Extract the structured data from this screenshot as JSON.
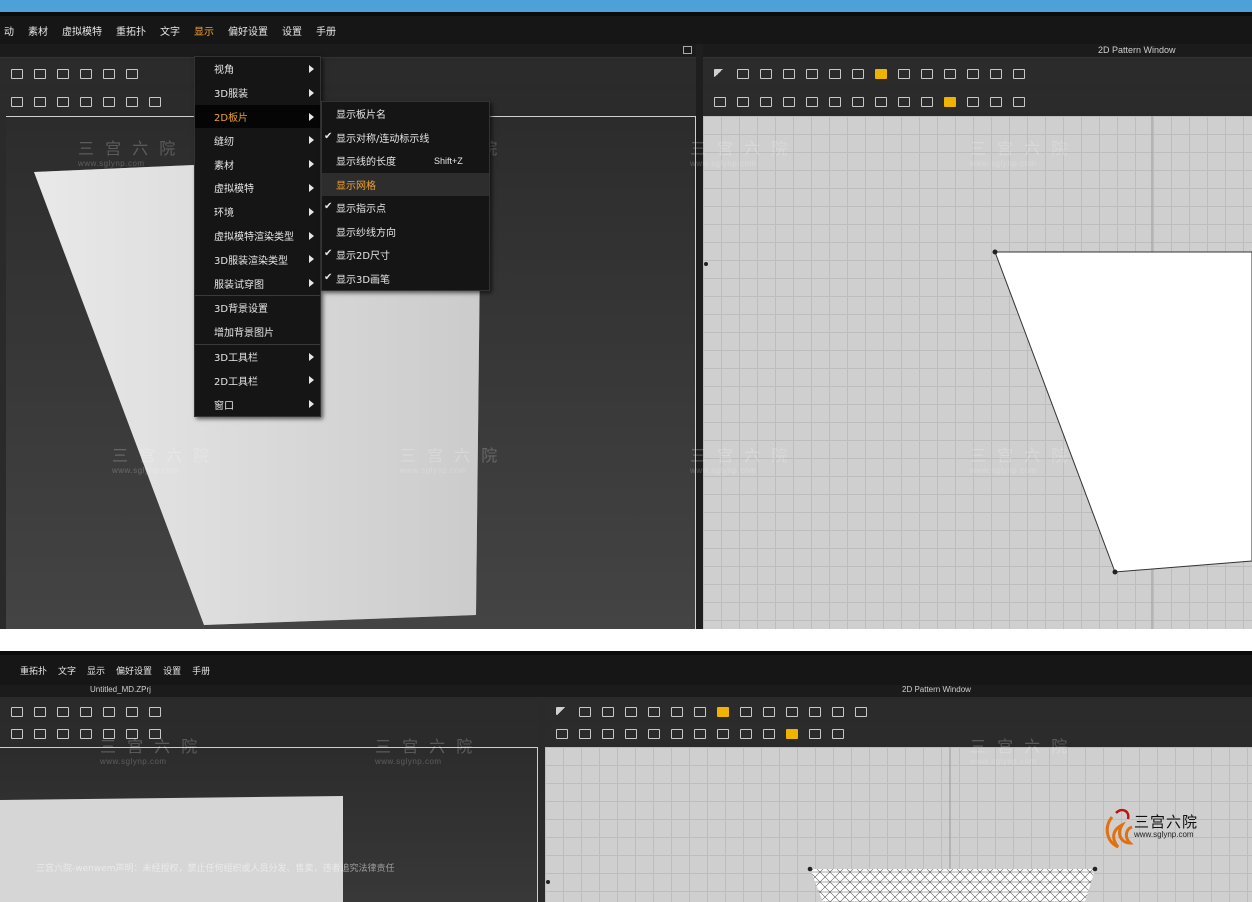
{
  "top": {
    "menu": [
      "动",
      "素材",
      "虚拟模特",
      "重拓扑",
      "文字",
      "显示",
      "偏好设置",
      "设置",
      "手册"
    ],
    "active_menu_index": 5,
    "pattern_window_title": "2D Pattern Window"
  },
  "display_menu": {
    "items": [
      {
        "label": "视角",
        "arrow": true
      },
      {
        "label": "3D服装",
        "arrow": true
      },
      {
        "label": "2D板片",
        "arrow": true
      },
      {
        "label": "缝纫",
        "arrow": true
      },
      {
        "label": "素材",
        "arrow": true
      },
      {
        "label": "虚拟模特",
        "arrow": true
      },
      {
        "label": "环境",
        "arrow": true
      },
      {
        "label": "虚拟模特渲染类型",
        "arrow": true
      },
      {
        "label": "3D服装渲染类型",
        "arrow": true
      },
      {
        "label": "服装试穿图",
        "arrow": true
      },
      {
        "label": "3D背景设置",
        "arrow": false
      },
      {
        "label": "增加背景图片",
        "arrow": false
      },
      {
        "label": "3D工具栏",
        "arrow": true
      },
      {
        "label": "2D工具栏",
        "arrow": true
      },
      {
        "label": "窗口",
        "arrow": true
      }
    ],
    "active_index": 2
  },
  "submenu_2d_pattern": {
    "items": [
      {
        "label": "显示板片名",
        "checked": false,
        "shortcut": ""
      },
      {
        "label": "显示对称/连动标示线",
        "checked": true,
        "shortcut": ""
      },
      {
        "label": "显示线的长度",
        "checked": false,
        "shortcut": "Shift+Z"
      },
      {
        "label": "显示网格",
        "checked": false,
        "shortcut": ""
      },
      {
        "label": "显示指示点",
        "checked": true,
        "shortcut": ""
      },
      {
        "label": "显示纱线方向",
        "checked": false,
        "shortcut": ""
      },
      {
        "label": "显示2D尺寸",
        "checked": true,
        "shortcut": ""
      },
      {
        "label": "显示3D画笔",
        "checked": true,
        "shortcut": ""
      }
    ],
    "active_index": 3
  },
  "bottom": {
    "menu": [
      "重拓扑",
      "文字",
      "显示",
      "偏好设置",
      "设置",
      "手册"
    ],
    "project_title": "Untitled_MD.ZPrj",
    "pattern_window_title": "2D Pattern Window",
    "notice": "三宫六院-wenwem声明：未经授权，禁止任何组织或人员分发、售卖，违者追究法律责任"
  },
  "watermark": {
    "text": "三 宫 六 院",
    "url": "www.sglynp.com"
  },
  "logo": {
    "text": "三宫六院",
    "url": "www.sglynp.com"
  },
  "colors": {
    "accent_blue": "#4ea0d8",
    "menu_highlight": "#f0a030",
    "toolbar_yellow": "#f0b400"
  }
}
